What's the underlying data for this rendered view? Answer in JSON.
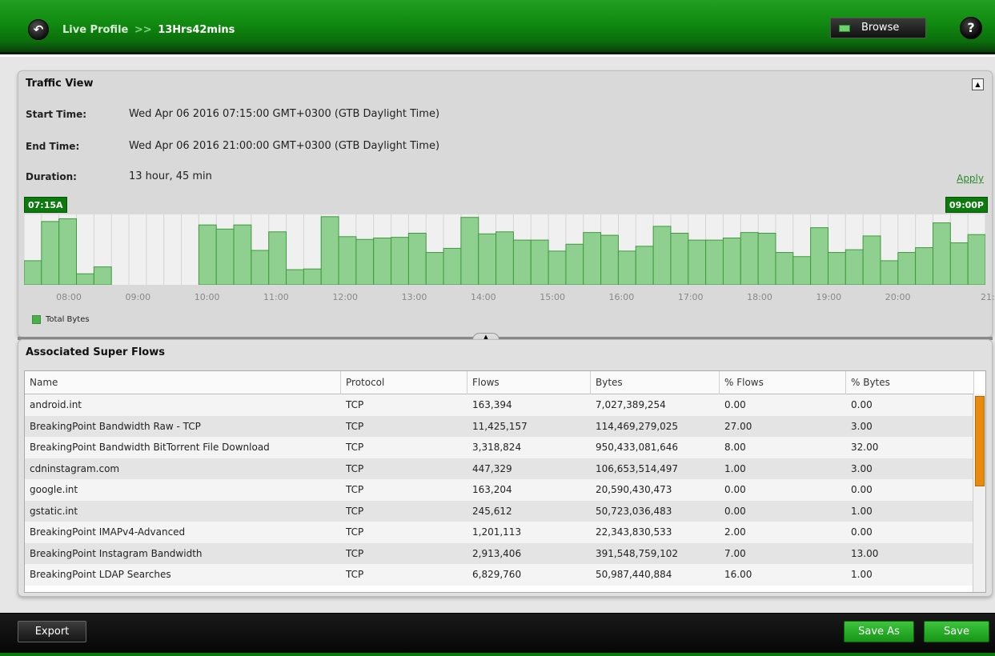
{
  "header": {
    "back_icon": "back-arrow-icon",
    "breadcrumb_root": "Live Profile",
    "breadcrumb_sep": ">>",
    "breadcrumb_current": "13Hrs42mins",
    "browse_label": "Browse",
    "help_label": "?"
  },
  "traffic": {
    "title": "Traffic View",
    "start_label": "Start Time:",
    "start_value": "Wed Apr 06 2016 07:15:00 GMT+0300 (GTB Daylight Time)",
    "end_label": "End Time:",
    "end_value": "Wed Apr 06 2016 21:00:00 GMT+0300 (GTB Daylight Time)",
    "duration_label": "Duration:",
    "duration_value": "13 hour, 45 min",
    "apply_label": "Apply",
    "start_marker": "07:15A",
    "end_marker": "09:00P",
    "legend": "Total Bytes"
  },
  "chart_data": {
    "type": "area",
    "title": "",
    "xlabel": "",
    "ylabel": "",
    "x_ticks": [
      "08:00",
      "09:00",
      "10:00",
      "11:00",
      "12:00",
      "13:00",
      "14:00",
      "15:00",
      "16:00",
      "17:00",
      "18:00",
      "19:00",
      "20:00",
      "21:"
    ],
    "series": [
      {
        "name": "Total Bytes",
        "color": "#8fcf8f",
        "values": [
          0.35,
          0.92,
          0.96,
          0.16,
          0.26,
          0,
          0,
          0,
          0,
          0,
          0.87,
          0.81,
          0.87,
          0.5,
          0.77,
          0.22,
          0.23,
          0.99,
          0.7,
          0.66,
          0.68,
          0.69,
          0.75,
          0.47,
          0.53,
          0.98,
          0.74,
          0.77,
          0.65,
          0.65,
          0.49,
          0.59,
          0.76,
          0.72,
          0.49,
          0.56,
          0.85,
          0.75,
          0.65,
          0.65,
          0.68,
          0.76,
          0.75,
          0.47,
          0.41,
          0.83,
          0.47,
          0.51,
          0.71,
          0.35,
          0.47,
          0.54,
          0.9,
          0.61,
          0.73
        ]
      }
    ],
    "legend_position": "bottom-left",
    "grid": true
  },
  "flows": {
    "title": "Associated Super Flows",
    "columns": [
      "Name",
      "Protocol",
      "Flows",
      "Bytes",
      "% Flows",
      "% Bytes"
    ],
    "rows": [
      [
        "android.int",
        "TCP",
        "163,394",
        "7,027,389,254",
        "0.00",
        "0.00"
      ],
      [
        "BreakingPoint Bandwidth Raw - TCP",
        "TCP",
        "11,425,157",
        "114,469,279,025",
        "27.00",
        "3.00"
      ],
      [
        "BreakingPoint Bandwidth BitTorrent File Download",
        "TCP",
        "3,318,824",
        "950,433,081,646",
        "8.00",
        "32.00"
      ],
      [
        "cdninstagram.com",
        "TCP",
        "447,329",
        "106,653,514,497",
        "1.00",
        "3.00"
      ],
      [
        "google.int",
        "TCP",
        "163,204",
        "20,590,430,473",
        "0.00",
        "0.00"
      ],
      [
        "gstatic.int",
        "TCP",
        "245,612",
        "50,723,036,483",
        "0.00",
        "1.00"
      ],
      [
        "BreakingPoint IMAPv4-Advanced",
        "TCP",
        "1,201,113",
        "22,343,830,533",
        "2.00",
        "0.00"
      ],
      [
        "BreakingPoint Instagram Bandwidth",
        "TCP",
        "2,913,406",
        "391,548,759,102",
        "7.00",
        "13.00"
      ],
      [
        "BreakingPoint LDAP Searches",
        "TCP",
        "6,829,760",
        "50,987,440,884",
        "16.00",
        "1.00"
      ]
    ]
  },
  "footer": {
    "export_label": "Export",
    "save_as_label": "Save As",
    "save_label": "Save"
  }
}
